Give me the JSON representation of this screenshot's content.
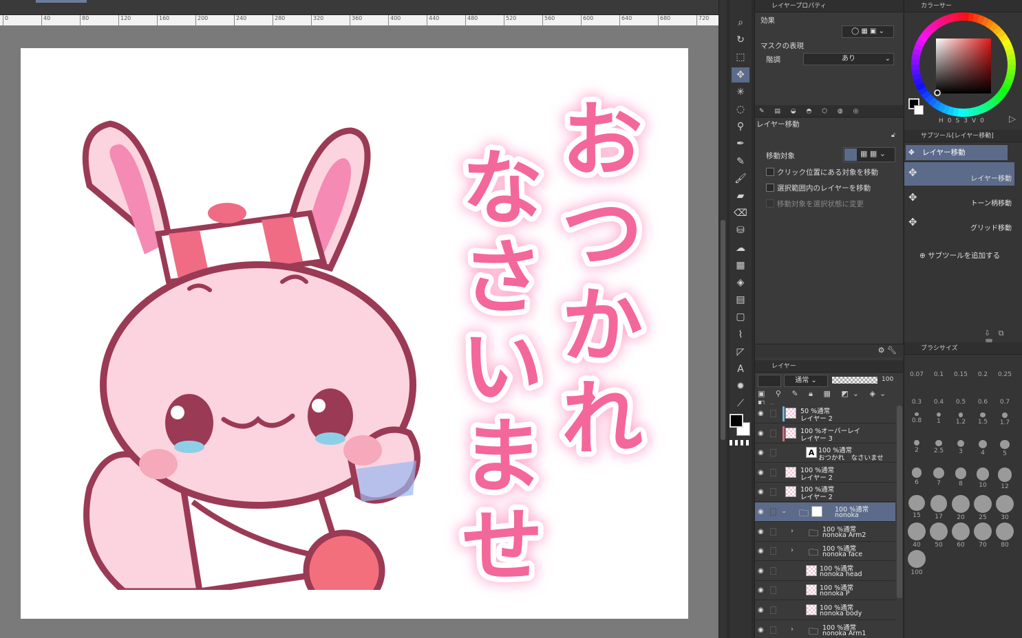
{
  "ruler": {
    "ticks": [
      "0",
      "40",
      "80",
      "120",
      "160",
      "200",
      "240",
      "280",
      "320",
      "360",
      "400",
      "440",
      "480",
      "520",
      "560",
      "600",
      "640",
      "680",
      "720"
    ]
  },
  "artwork": {
    "line1": [
      "お",
      "つ",
      "か",
      "れ"
    ],
    "line2": [
      "な",
      "さ",
      "い",
      "ま",
      "せ"
    ],
    "text_color": "#f4679a",
    "glow_color": "#ffb3d2",
    "character": {
      "body": "#fcd4df",
      "outline": "#9b3a55",
      "ear_inner": "#f58ab4",
      "hat_stripe": "#ef6c84",
      "cheek": "#f6a9ba",
      "tear": "#8ecfe8"
    }
  },
  "tools": {
    "icons": [
      "zoom-icon",
      "rotate-icon",
      "object-icon",
      "move-icon",
      "auto-select-icon",
      "lasso-icon",
      "eyedropper-icon",
      "pen-icon",
      "pencil-icon",
      "brush-icon",
      "airbrush-icon",
      "eraser-icon",
      "fill-icon",
      "blend-icon",
      "frame-icon",
      "bucket-icon",
      "gradient-icon",
      "rectangle-icon",
      "ruler-icon",
      "line-icon",
      "text-icon",
      "effect-icon",
      "correction-icon"
    ]
  },
  "layer_property": {
    "title": "レイヤープロパティ",
    "effect_label": "効果",
    "mask_expression": "マスクの表現",
    "tone_label": "階調",
    "tone_value": "あり"
  },
  "tool_property": {
    "title": "レイヤー移動",
    "move_target": "移動対象",
    "options": [
      {
        "label": "クリック位置にある対象を移動",
        "enabled": true
      },
      {
        "label": "選択範囲内のレイヤーを移動",
        "enabled": true
      },
      {
        "label": "移動対象を選択状態に変更",
        "enabled": false
      }
    ]
  },
  "layers_panel": {
    "title": "レイヤー",
    "blend_mode": "通常",
    "opacity": "100",
    "layers": [
      {
        "l1": "50 %通常",
        "l2": "レイヤー 2",
        "indent": 0,
        "mark": "#6fb6d9",
        "folder": false,
        "sel": false
      },
      {
        "l1": "100 %オーバーレイ",
        "l2": "レイヤー 3",
        "indent": 0,
        "mark": "#d56a7a",
        "folder": false,
        "sel": false
      },
      {
        "l1": "100 %通常",
        "l2": "おつかれ　なさいませ",
        "indent": 0,
        "mark": "",
        "folder": false,
        "text": true,
        "sel": false
      },
      {
        "l1": "100 %通常",
        "l2": "レイヤー 2",
        "indent": 0,
        "mark": "",
        "folder": false,
        "sel": false
      },
      {
        "l1": "100 %通常",
        "l2": "レイヤー 2",
        "indent": 0,
        "mark": "",
        "folder": false,
        "sel": false
      },
      {
        "l1": "100 %通常",
        "l2": "nonoka",
        "indent": 0,
        "mark": "",
        "folder": true,
        "open": true,
        "sel": true
      },
      {
        "l1": "100 %通常",
        "l2": "nonoka Arm2",
        "indent": 1,
        "mark": "",
        "folder": true,
        "sel": false
      },
      {
        "l1": "100 %通常",
        "l2": "nonoka face",
        "indent": 1,
        "mark": "",
        "folder": true,
        "sel": false
      },
      {
        "l1": "100 %通常",
        "l2": "nonoka head",
        "indent": 1,
        "mark": "",
        "folder": false,
        "sel": false
      },
      {
        "l1": "100 %通常",
        "l2": "nonoka P",
        "indent": 1,
        "mark": "",
        "folder": false,
        "sel": false
      },
      {
        "l1": "100 %通常",
        "l2": "nonoka body",
        "indent": 1,
        "mark": "",
        "folder": false,
        "sel": false
      },
      {
        "l1": "100 %通常",
        "l2": "nonoka Arm1",
        "indent": 1,
        "mark": "",
        "folder": true,
        "sel": false
      }
    ]
  },
  "color_panel": {
    "title": "カラーサー",
    "readout": [
      "H",
      "0",
      "S",
      "3",
      "V",
      "0"
    ]
  },
  "subtool_panel": {
    "title": "サブツール[レイヤー移動]",
    "group": "レイヤー移動",
    "items": [
      "レイヤー移動",
      "トーン柄移動",
      "グリッド移動"
    ],
    "add_label": "サブツールを追加する"
  },
  "brush_size": {
    "title": "ブラシサイズ",
    "sizes": [
      "0.07",
      "0.1",
      "0.15",
      "0.2",
      "0.25",
      "0.3",
      "0.4",
      "0.5",
      "0.6",
      "0.7",
      "0.8",
      "1",
      "1.2",
      "1.5",
      "1.7",
      "2",
      "2.5",
      "3",
      "4",
      "5",
      "6",
      "7",
      "8",
      "10",
      "12",
      "15",
      "17",
      "20",
      "25",
      "30",
      "40",
      "50",
      "60",
      "70",
      "80",
      "100"
    ]
  }
}
